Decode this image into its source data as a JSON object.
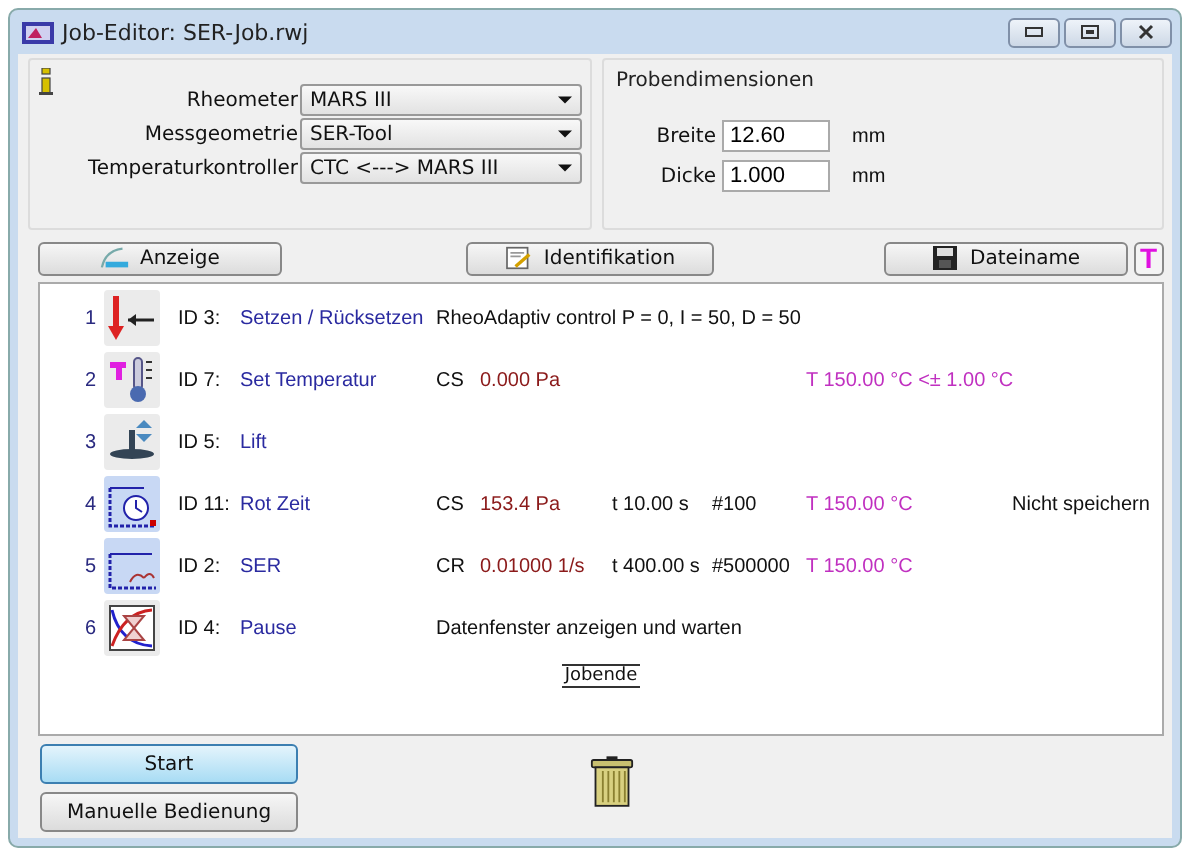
{
  "window": {
    "title": "Job-Editor: SER-Job.rwj"
  },
  "settings": [
    {
      "label": "Rheometer",
      "value": "MARS III"
    },
    {
      "label": "Messgeometrie",
      "value": "SER-Tool"
    },
    {
      "label": "Temperaturkontroller",
      "value": "CTC <---> MARS III"
    }
  ],
  "sample_dimensions": {
    "title": "Probendimensionen",
    "fields": [
      {
        "label": "Breite",
        "value": "12.60",
        "unit": "mm"
      },
      {
        "label": "Dicke",
        "value": "1.000",
        "unit": "mm"
      }
    ]
  },
  "toolbar": [
    {
      "kind": "display",
      "label": "Anzeige"
    },
    {
      "kind": "identification",
      "label": "Identifikation"
    },
    {
      "kind": "filename",
      "label": "Dateiname"
    }
  ],
  "text_button": "T",
  "steps": [
    {
      "kind": "set",
      "number": "1",
      "id": "ID 3:",
      "name": "Setzen / Rücksetzen",
      "description": "RheoAdaptiv control P = 0, I = 50, D = 50"
    },
    {
      "kind": "temperature",
      "number": "2",
      "id": "ID 7:",
      "name": "Set Temperatur",
      "mode": "CS",
      "value": "0.000 Pa",
      "temperature": "T 150.00 °C <± 1.00 °C"
    },
    {
      "kind": "lift",
      "number": "3",
      "id": "ID 5:",
      "name": "Lift"
    },
    {
      "kind": "rot",
      "number": "4",
      "id": "ID 11:",
      "name": "Rot Zeit",
      "mode": "CS",
      "value": "153.4 Pa",
      "time": "t 10.00 s",
      "count": "#100",
      "temperature": "T 150.00 °C",
      "note": "Nicht speichern"
    },
    {
      "kind": "ser",
      "number": "5",
      "id": "ID 2:",
      "name": "SER",
      "mode": "CR",
      "value": "0.01000 1/s",
      "time": "t 400.00 s",
      "count": "#500000",
      "temperature": "T 150.00 °C"
    },
    {
      "kind": "pause",
      "number": "6",
      "id": "ID 4:",
      "name": "Pause",
      "description": "Datenfenster anzeigen und warten"
    }
  ],
  "job_end": "Jobende",
  "buttons": [
    {
      "label": "Start",
      "selected": true
    },
    {
      "label": "Manuelle Bedienung",
      "selected": false
    }
  ]
}
